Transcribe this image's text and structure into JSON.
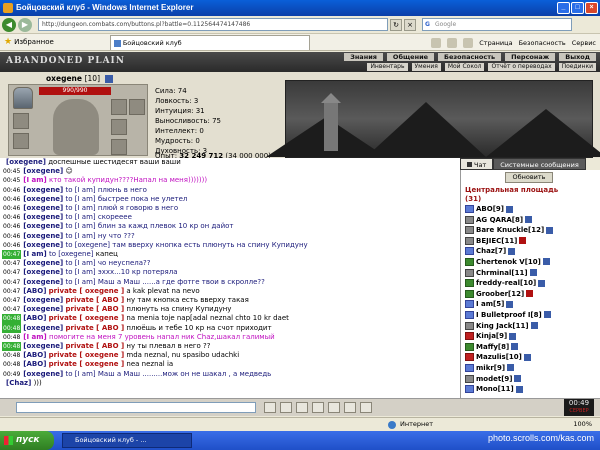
{
  "window": {
    "title": "Бойцовский клуб - Windows Internet Explorer"
  },
  "browser": {
    "address": "http://dungeon.combats.com/buttons.pl?battle=0.112564474147486",
    "search_placeholder": "Google",
    "favorites_label": "Избранное",
    "tab_title": "Бойцовский клуб",
    "commands": [
      "Страница",
      "Безопасность",
      "Сервис"
    ]
  },
  "game": {
    "logo": "ABANDONED PLAIN",
    "nav": [
      "Знания",
      "Общение",
      "Безопасность",
      "Персонаж",
      "Выход"
    ],
    "subnav": [
      "Инвентарь",
      "Умения",
      "Мой Сокол",
      "Отчёт о переводах",
      "Поединки"
    ]
  },
  "character": {
    "name": "oxegene",
    "level": "[10]",
    "hp": "990/990",
    "stats": [
      "Сила: 74",
      "Ловкость: 3",
      "Интуиция: 31",
      "Выносливость: 75",
      "Интеллект: 0",
      "Мудрость: 0",
      "Духовность: 3"
    ],
    "exp_label": "Опыт:",
    "exp_value": "32 249 712",
    "exp_next": "(34 000 000)"
  },
  "chat": {
    "tabs": [
      "Чат",
      "Системные сообщения"
    ],
    "lines": [
      {
        "ts": "",
        "hl": false,
        "name": "[oxegene]",
        "to": "",
        "priv": "",
        "text": "доспешные шестидесят ваши ваши",
        "cls": "",
        "row": ""
      },
      {
        "ts": "00:45",
        "hl": false,
        "name": "[oxegene]",
        "to": "",
        "priv": "",
        "text": "☺",
        "cls": "",
        "row": ""
      },
      {
        "ts": "00:45",
        "hl": false,
        "name": "[I am]",
        "to": "",
        "priv": "",
        "text": "кто такой купидун????Напал на меня)))))))",
        "cls": "pink",
        "row": "pinkrow"
      },
      {
        "ts": "00:46",
        "hl": false,
        "name": "[oxegene]",
        "to": "to [I am]",
        "priv": "",
        "text": "плюнь в него",
        "cls": "blue",
        "row": ""
      },
      {
        "ts": "00:46",
        "hl": false,
        "name": "[oxegene]",
        "to": "to [I am]",
        "priv": "",
        "text": "быстрее пока не улетел",
        "cls": "blue",
        "row": ""
      },
      {
        "ts": "00:46",
        "hl": false,
        "name": "[oxegene]",
        "to": "to [I am]",
        "priv": "",
        "text": "плюй я говорю в него",
        "cls": "blue",
        "row": ""
      },
      {
        "ts": "00:46",
        "hl": false,
        "name": "[oxegene]",
        "to": "to [I am]",
        "priv": "",
        "text": "скорееее",
        "cls": "blue",
        "row": ""
      },
      {
        "ts": "00:46",
        "hl": false,
        "name": "[oxegene]",
        "to": "to [I am]",
        "priv": "",
        "text": "блин за кажд плевок 10 кр он дайот",
        "cls": "blue",
        "row": ""
      },
      {
        "ts": "00:46",
        "hl": false,
        "name": "[oxegene]",
        "to": "to [I am]",
        "priv": "",
        "text": "ну что ???",
        "cls": "blue",
        "row": ""
      },
      {
        "ts": "00:46",
        "hl": false,
        "name": "[oxegene]",
        "to": "to [oxegene]",
        "priv": "",
        "text": "там вверху кнопка есть плюнуть на спину Купидуну",
        "cls": "blue",
        "row": ""
      },
      {
        "ts": "00:47",
        "hl": true,
        "name": "[I am]",
        "to": "to [oxegene]",
        "priv": "",
        "text": "капец",
        "cls": "",
        "row": ""
      },
      {
        "ts": "00:47",
        "hl": false,
        "name": "[oxegene]",
        "to": "to [I am]",
        "priv": "",
        "text": "чо неуспела??",
        "cls": "blue",
        "row": ""
      },
      {
        "ts": "00:47",
        "hl": false,
        "name": "[oxegene]",
        "to": "to [I am]",
        "priv": "",
        "text": "эххх...10 кр потеряла",
        "cls": "blue",
        "row": ""
      },
      {
        "ts": "00:47",
        "hl": false,
        "name": "[oxegene]",
        "to": "to [I am]",
        "priv": "",
        "text": "Маш а Маш ......а где фотге твои в скролле??",
        "cls": "blue",
        "row": ""
      },
      {
        "ts": "00:47",
        "hl": false,
        "name": "[ABO]",
        "to": "",
        "priv": "private [ oxegene ]",
        "text": "a kak plevat na nevo",
        "cls": "",
        "row": ""
      },
      {
        "ts": "00:47",
        "hl": false,
        "name": "[oxegene]",
        "to": "",
        "priv": "private [ ABO ]",
        "text": "ну там кнопка есть вверху такая",
        "cls": "",
        "row": ""
      },
      {
        "ts": "00:47",
        "hl": false,
        "name": "[oxegene]",
        "to": "",
        "priv": "private [ ABO ]",
        "text": "плюнуть на спину Купидуну",
        "cls": "",
        "row": ""
      },
      {
        "ts": "00:48",
        "hl": true,
        "name": "[ABO]",
        "to": "",
        "priv": "private [ oxegene ]",
        "text": "na menia toje nap[adal neznal chto 10 kr daet",
        "cls": "",
        "row": ""
      },
      {
        "ts": "00:48",
        "hl": true,
        "name": "[oxegene]",
        "to": "",
        "priv": "private [ ABO ]",
        "text": "плюёшь и тебе 10 кр на счот приходит",
        "cls": "",
        "row": ""
      },
      {
        "ts": "00:48",
        "hl": false,
        "name": "[I am]",
        "to": "",
        "priv": "",
        "text": "помогите на меня 7 уровень напал ник Chaz,шакал галимый",
        "cls": "pink",
        "row": "pinkrow"
      },
      {
        "ts": "00:48",
        "hl": true,
        "name": "[oxegene]",
        "to": "",
        "priv": "private [ ABO ]",
        "text": "ну ты плевал в него ??",
        "cls": "",
        "row": ""
      },
      {
        "ts": "00:48",
        "hl": false,
        "name": "[ABO]",
        "to": "",
        "priv": "private [ oxegene ]",
        "text": "mda neznal, nu spasibo udachki",
        "cls": "",
        "row": ""
      },
      {
        "ts": "00:48",
        "hl": false,
        "name": "[ABO]",
        "to": "",
        "priv": "private [ oxegene ]",
        "text": "nea neznal ia",
        "cls": "",
        "row": ""
      },
      {
        "ts": "00:49",
        "hl": false,
        "name": "[oxegene]",
        "to": "to [I am]",
        "priv": "",
        "text": "Маш а Маш .........мож он не шакал , а медведь",
        "cls": "blue",
        "row": ""
      },
      {
        "ts": "",
        "hl": false,
        "name": "[Chaz]",
        "to": "",
        "priv": "",
        "text": ")))",
        "cls": "",
        "row": ""
      }
    ]
  },
  "side": {
    "refresh_label": "Обновить",
    "location": "Центральная площадь",
    "count": "(31)",
    "players": [
      {
        "name": "ABO[9]",
        "icon": "",
        "badge": "b"
      },
      {
        "name": "AG QARA[8]",
        "icon": "d",
        "badge": "b"
      },
      {
        "name": "Bare Knuckle[12]",
        "icon": "d",
        "badge": "b"
      },
      {
        "name": "BEJIEC[11]",
        "icon": "d",
        "badge": "r"
      },
      {
        "name": "Chaz[7]",
        "icon": "",
        "badge": "b"
      },
      {
        "name": "Chertenok V[10]",
        "icon": "g",
        "badge": "b"
      },
      {
        "name": "Chrminal[11]",
        "icon": "d",
        "badge": "b"
      },
      {
        "name": "freddy-real[10]",
        "icon": "g",
        "badge": "b"
      },
      {
        "name": "Groober[12]",
        "icon": "g",
        "badge": "r"
      },
      {
        "name": "I am[5]",
        "icon": "",
        "badge": "b"
      },
      {
        "name": "I Bulletproof I[8]",
        "icon": "",
        "badge": "b"
      },
      {
        "name": "King Jack[11]",
        "icon": "d",
        "badge": "b"
      },
      {
        "name": "Kinja[9]",
        "icon": "r",
        "badge": "b"
      },
      {
        "name": "Maffy[8]",
        "icon": "g",
        "badge": "b"
      },
      {
        "name": "Mazulis[10]",
        "icon": "r",
        "badge": "b"
      },
      {
        "name": "mikr[9]",
        "icon": "",
        "badge": "b"
      },
      {
        "name": "modet[9]",
        "icon": "d",
        "badge": "b"
      },
      {
        "name": "Mono[11]",
        "icon": "",
        "badge": "b"
      }
    ]
  },
  "chatbar": {
    "clock": "00:49",
    "clock_sub": "СЕРВЕР"
  },
  "status": {
    "zone": "Интернет",
    "zoom": "100%"
  },
  "taskbar": {
    "start": "пуск",
    "task": "Бойцовский клуб - ...",
    "watermark": "photo.scrolls.com/kas.com"
  }
}
